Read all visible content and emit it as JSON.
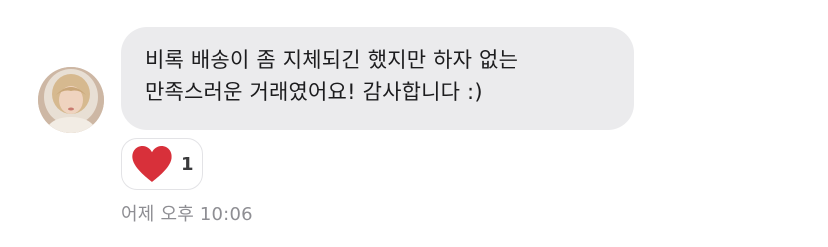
{
  "message": {
    "text": "비록 배송이 좀 지체되긴 했지만 하자 없는\n만족스러운 거래였어요! 감사합니다 :)",
    "timestamp": "어제 오후 10:06"
  },
  "reaction": {
    "icon": "heart-icon",
    "count": "1",
    "color": "#d8303a"
  },
  "colors": {
    "bubble_background": "#ebebed",
    "text": "#1c1c1e",
    "timestamp": "#8e8e93"
  }
}
